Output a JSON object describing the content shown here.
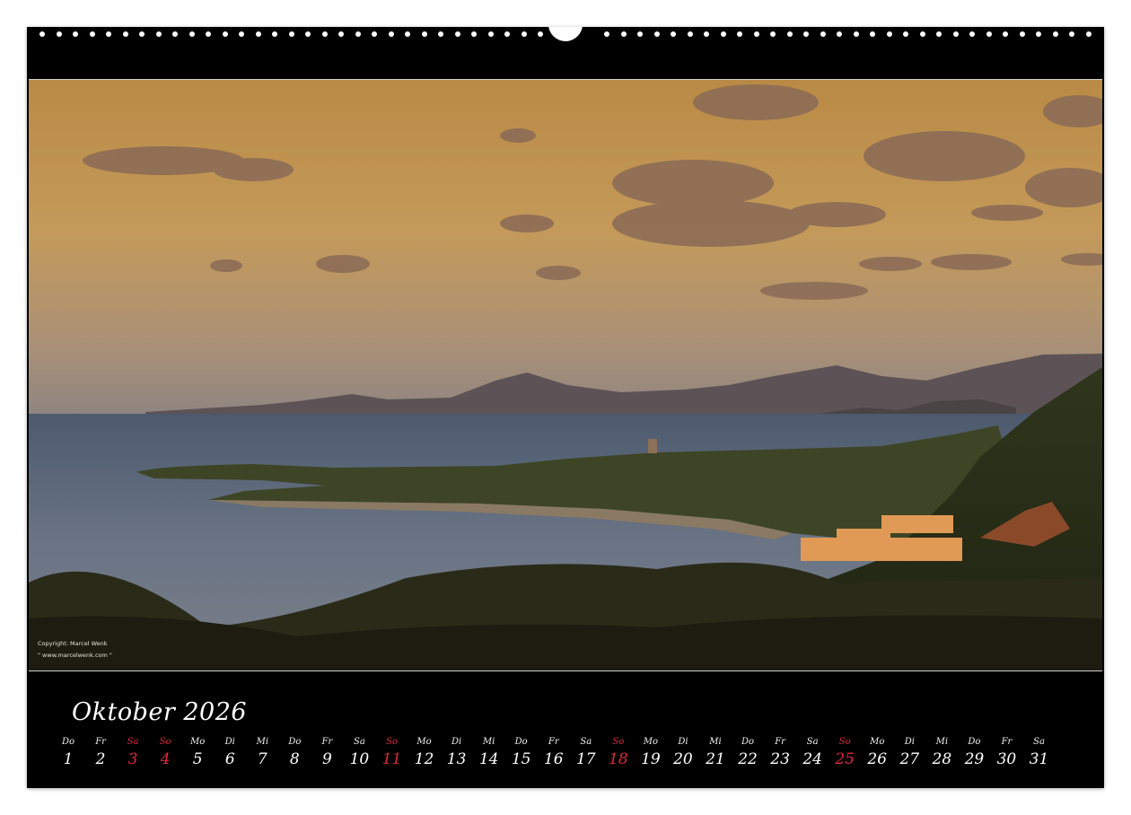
{
  "calendar": {
    "month_title": "Oktober 2026",
    "copyright_line1": "Copyright: Marcel Wenk",
    "copyright_line2": "\" www.marcelwenk.com \"",
    "days": [
      {
        "wd": "Do",
        "n": "1",
        "red": false
      },
      {
        "wd": "Fr",
        "n": "2",
        "red": false
      },
      {
        "wd": "Sa",
        "n": "3",
        "red": true
      },
      {
        "wd": "So",
        "n": "4",
        "red": true
      },
      {
        "wd": "Mo",
        "n": "5",
        "red": false
      },
      {
        "wd": "Di",
        "n": "6",
        "red": false
      },
      {
        "wd": "Mi",
        "n": "7",
        "red": false
      },
      {
        "wd": "Do",
        "n": "8",
        "red": false
      },
      {
        "wd": "Fr",
        "n": "9",
        "red": false
      },
      {
        "wd": "Sa",
        "n": "10",
        "red": false
      },
      {
        "wd": "So",
        "n": "11",
        "red": true
      },
      {
        "wd": "Mo",
        "n": "12",
        "red": false
      },
      {
        "wd": "Di",
        "n": "13",
        "red": false
      },
      {
        "wd": "Mi",
        "n": "14",
        "red": false
      },
      {
        "wd": "Do",
        "n": "15",
        "red": false
      },
      {
        "wd": "Fr",
        "n": "16",
        "red": false
      },
      {
        "wd": "Sa",
        "n": "17",
        "red": false
      },
      {
        "wd": "So",
        "n": "18",
        "red": true
      },
      {
        "wd": "Mo",
        "n": "19",
        "red": false
      },
      {
        "wd": "Di",
        "n": "20",
        "red": false
      },
      {
        "wd": "Mi",
        "n": "21",
        "red": false
      },
      {
        "wd": "Do",
        "n": "22",
        "red": false
      },
      {
        "wd": "Fr",
        "n": "23",
        "red": false
      },
      {
        "wd": "Sa",
        "n": "24",
        "red": false
      },
      {
        "wd": "So",
        "n": "25",
        "red": true
      },
      {
        "wd": "Mo",
        "n": "26",
        "red": false
      },
      {
        "wd": "Di",
        "n": "27",
        "red": false
      },
      {
        "wd": "Mi",
        "n": "28",
        "red": false
      },
      {
        "wd": "Do",
        "n": "29",
        "red": false
      },
      {
        "wd": "Fr",
        "n": "30",
        "red": false
      },
      {
        "wd": "Sa",
        "n": "31",
        "red": false
      }
    ]
  },
  "colors": {
    "holiday_red": "#e0283a",
    "page_black": "#000000",
    "sky_amber": "#c49a5a"
  }
}
